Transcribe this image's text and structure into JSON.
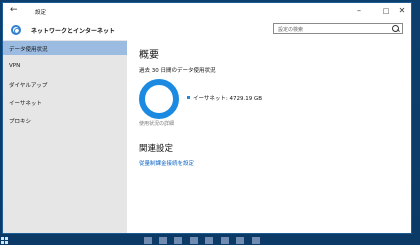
{
  "window": {
    "title": "設定"
  },
  "header": {
    "title": "ネットワークとインターネット",
    "search_placeholder": "設定の検索"
  },
  "sidebar": {
    "items": [
      {
        "label": "データ使用状況",
        "active": true
      },
      {
        "label": "VPN"
      },
      {
        "label": "ダイヤルアップ"
      },
      {
        "label": "イーサネット"
      },
      {
        "label": "プロキシ"
      }
    ]
  },
  "main": {
    "overview_title": "概要",
    "subtitle": "過去 30 日間のデータ使用状況",
    "usage": [
      {
        "name": "イーサネット",
        "value": "4729.19 GB",
        "color": "#1b8ae0"
      }
    ],
    "details_link": "使用状況の詳細",
    "related_title": "関連設定",
    "metered_link": "従量制課金接続を設定"
  },
  "colors": {
    "accent": "#1b8ae0",
    "sidebar_active": "#9bbbe1",
    "link": "#0a64c8",
    "desktop": "#0d3f6e"
  },
  "icons": [
    "back-arrow-icon",
    "minimize-icon",
    "maximize-icon",
    "close-icon",
    "gear-icon",
    "search-icon",
    "start-icon"
  ]
}
